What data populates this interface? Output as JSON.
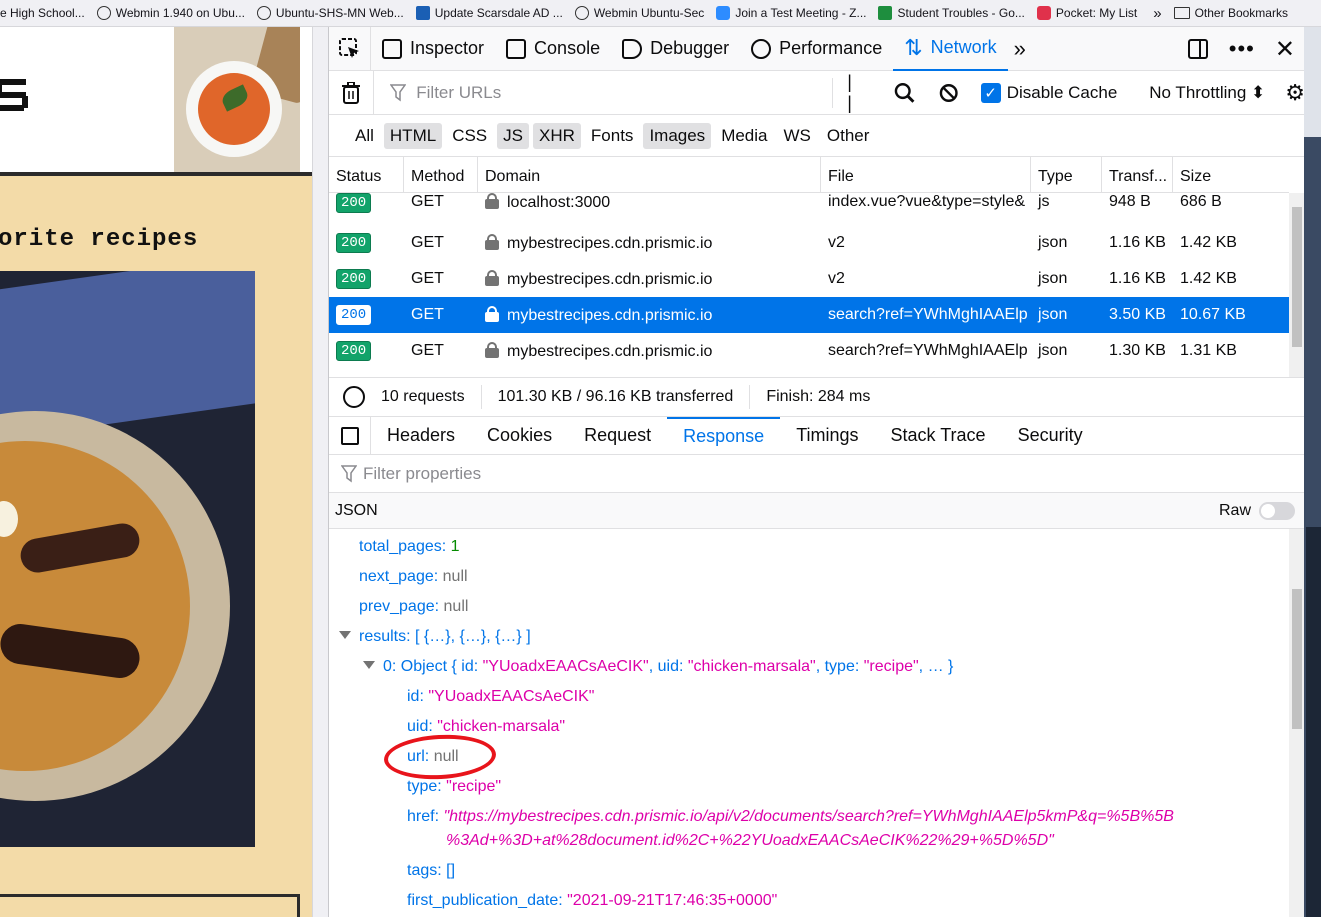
{
  "bookmarks": [
    {
      "label": "e High School...",
      "icon": "globe-icon"
    },
    {
      "label": "Webmin 1.940 on Ubu...",
      "icon": "globe-icon"
    },
    {
      "label": "Ubuntu-SHS-MN Web...",
      "icon": "globe-icon"
    },
    {
      "label": "Update Scarsdale AD ...",
      "icon": "powershell-icon"
    },
    {
      "label": "Webmin Ubuntu-Sec",
      "icon": "globe-icon"
    },
    {
      "label": "Join a Test Meeting - Z...",
      "icon": "zoom-icon"
    },
    {
      "label": "Student Troubles - Go...",
      "icon": "sheets-icon"
    },
    {
      "label": "Pocket: My List",
      "icon": "pocket-icon"
    }
  ],
  "bookmarks_more": "»",
  "other_bookmarks": "Other Bookmarks",
  "page": {
    "logo_glyph": "S",
    "tagline": "orite recipes"
  },
  "devtools": {
    "tools": [
      {
        "label": "Inspector",
        "icon": "inspector-icon"
      },
      {
        "label": "Console",
        "icon": "console-icon"
      },
      {
        "label": "Debugger",
        "icon": "debugger-icon"
      },
      {
        "label": "Performance",
        "icon": "performance-icon"
      },
      {
        "label": "Network",
        "icon": "network-icon",
        "active": true
      }
    ],
    "more_tools": "»",
    "toolbar": {
      "filter_placeholder": "Filter URLs",
      "disable_cache_label": "Disable Cache",
      "disable_cache_checked": true,
      "throttling": "No Throttling ⬍"
    },
    "type_filters": [
      {
        "label": "All",
        "on": false
      },
      {
        "label": "HTML",
        "on": true
      },
      {
        "label": "CSS",
        "on": false
      },
      {
        "label": "JS",
        "on": true
      },
      {
        "label": "XHR",
        "on": true
      },
      {
        "label": "Fonts",
        "on": false
      },
      {
        "label": "Images",
        "on": true
      },
      {
        "label": "Media",
        "on": false
      },
      {
        "label": "WS",
        "on": false
      },
      {
        "label": "Other",
        "on": false
      }
    ],
    "columns": [
      "Status",
      "Method",
      "Domain",
      "File",
      "Type",
      "Transf...",
      "Size"
    ],
    "requests": [
      {
        "status": "200",
        "method": "GET",
        "domain": "localhost:3000",
        "file": "index.vue?vue&type=style&",
        "type": "js",
        "transferred": "948 B",
        "size": "686 B",
        "selected": false
      },
      {
        "status": "200",
        "method": "GET",
        "domain": "mybestrecipes.cdn.prismic.io",
        "file": "v2",
        "type": "json",
        "transferred": "1.16 KB",
        "size": "1.42 KB",
        "selected": false
      },
      {
        "status": "200",
        "method": "GET",
        "domain": "mybestrecipes.cdn.prismic.io",
        "file": "v2",
        "type": "json",
        "transferred": "1.16 KB",
        "size": "1.42 KB",
        "selected": false
      },
      {
        "status": "200",
        "method": "GET",
        "domain": "mybestrecipes.cdn.prismic.io",
        "file": "search?ref=YWhMghIAAElp",
        "type": "json",
        "transferred": "3.50 KB",
        "size": "10.67 KB",
        "selected": true
      },
      {
        "status": "200",
        "method": "GET",
        "domain": "mybestrecipes.cdn.prismic.io",
        "file": "search?ref=YWhMghIAAElp",
        "type": "json",
        "transferred": "1.30 KB",
        "size": "1.31 KB",
        "selected": false
      }
    ],
    "summary": {
      "requests": "10 requests",
      "transferred": "101.30 KB / 96.16 KB transferred",
      "finish": "Finish: 284 ms"
    },
    "detail_tabs": [
      {
        "label": "Headers",
        "active": false
      },
      {
        "label": "Cookies",
        "active": false
      },
      {
        "label": "Request",
        "active": false
      },
      {
        "label": "Response",
        "active": true
      },
      {
        "label": "Timings",
        "active": false
      },
      {
        "label": "Stack Trace",
        "active": false
      },
      {
        "label": "Security",
        "active": false
      }
    ],
    "filter_props_placeholder": "Filter properties",
    "json_label": "JSON",
    "raw_label": "Raw",
    "json": {
      "total_pages_key": "total_pages:",
      "total_pages_val": "1",
      "next_page_key": "next_page:",
      "next_page_val": "null",
      "prev_page_key": "prev_page:",
      "prev_page_val": "null",
      "results_key": "results:",
      "results_val": "[ {…}, {…}, {…} ]",
      "item0_key": "0:",
      "item0_prefix": "Object { id: ",
      "item0_id": "\"YUoadxEAACsAeCIK\"",
      "item0_mid": ", uid: ",
      "item0_uid": "\"chicken-marsala\"",
      "item0_mid2": ", type: ",
      "item0_type": "\"recipe\"",
      "item0_suffix": ", … }",
      "id_key": "id:",
      "id_val": "\"YUoadxEAACsAeCIK\"",
      "uid_key": "uid:",
      "uid_val": "\"chicken-marsala\"",
      "url_key": "url:",
      "url_val": "null",
      "type_key": "type:",
      "type_val": "\"recipe\"",
      "href_key": "href:",
      "href_val_1": "\"https://mybestrecipes.cdn.prismic.io/api/v2/documents/search?ref=YWhMghIAAElp5kmP&q=%5B%5B",
      "href_val_2": "%3Ad+%3D+at%28document.id%2C+%22YUoadxEAACsAeCIK%22%29+%5D%5D\"",
      "tags_key": "tags:",
      "tags_val": "[]",
      "fpd_key": "first_publication_date:",
      "fpd_val": "\"2021-09-21T17:46:35+0000\""
    }
  },
  "colors": {
    "accent": "#0074e8",
    "status_ok": "#12a36a",
    "json_string": "#dd00a9",
    "json_number": "#058b00",
    "annotation": "#e8141b"
  }
}
